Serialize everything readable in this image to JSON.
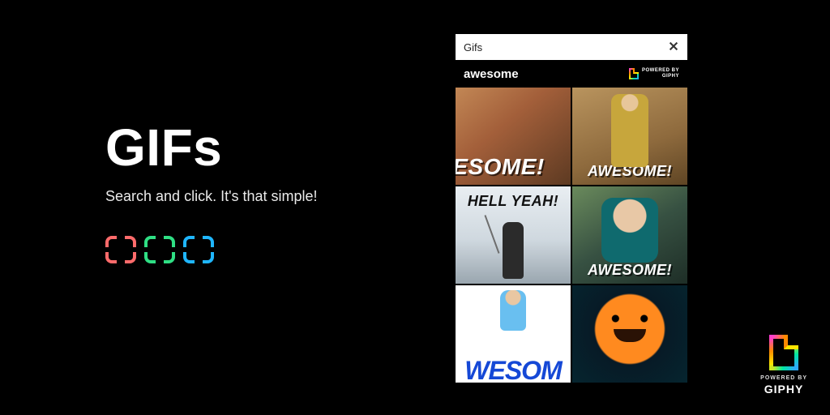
{
  "hero": {
    "headline": "GIFs",
    "subhead": "Search and click.  It's that simple!"
  },
  "panel": {
    "title": "Gifs",
    "search_value": "awesome",
    "attribution_prefix": "POWERED BY",
    "attribution_brand": "GIPHY",
    "results": [
      {
        "caption": "ESOME!"
      },
      {
        "caption": "AWESOME!"
      },
      {
        "caption": "HELL YEAH!"
      },
      {
        "caption": "AWESOME!"
      },
      {
        "caption": "WESOM"
      },
      {
        "caption": ""
      }
    ]
  },
  "giphy_badge": {
    "prefix": "POWERED BY",
    "brand": "GIPHY"
  },
  "colors": {
    "bracket_red": "#ff6b6b",
    "bracket_green": "#2fdf84",
    "bracket_blue": "#1fb6ff"
  }
}
